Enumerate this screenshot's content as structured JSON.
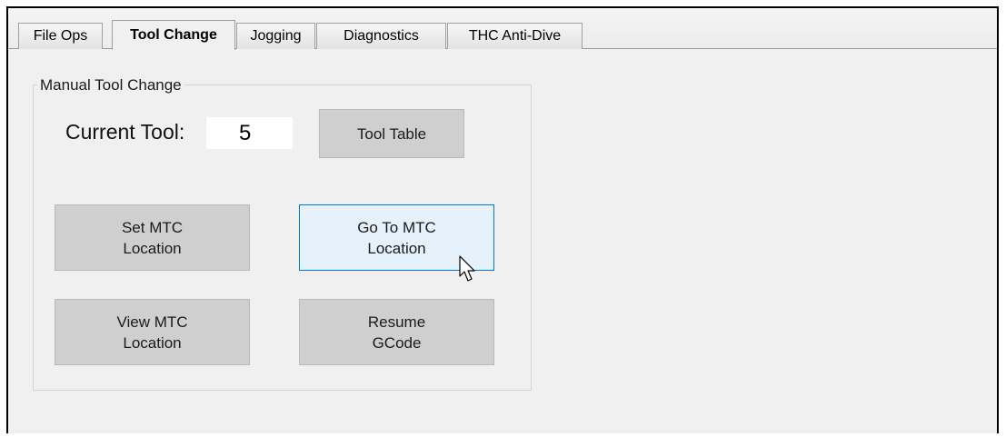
{
  "tabs": [
    {
      "label": "File Ops",
      "active": false
    },
    {
      "label": "Tool Change",
      "active": true
    },
    {
      "label": "Jogging",
      "active": false
    },
    {
      "label": "Diagnostics",
      "active": false
    },
    {
      "label": "THC Anti-Dive",
      "active": false
    }
  ],
  "group": {
    "title": "Manual Tool Change"
  },
  "current_tool": {
    "label": "Current Tool:",
    "value": "5"
  },
  "buttons": {
    "tool_table": "Tool Table",
    "set_mtc": "Set MTC\nLocation",
    "go_to_mtc": "Go To MTC\nLocation",
    "view_mtc": "View MTC\nLocation",
    "resume_gcode": "Resume\nGCode"
  },
  "colors": {
    "panel_background": "#f0f0f0",
    "button_face": "#cfcfcf",
    "button_hover_fill": "#e5f1fb",
    "button_hover_border": "#0078d7"
  },
  "icons": {
    "cursor": "arrow-pointer-icon"
  }
}
